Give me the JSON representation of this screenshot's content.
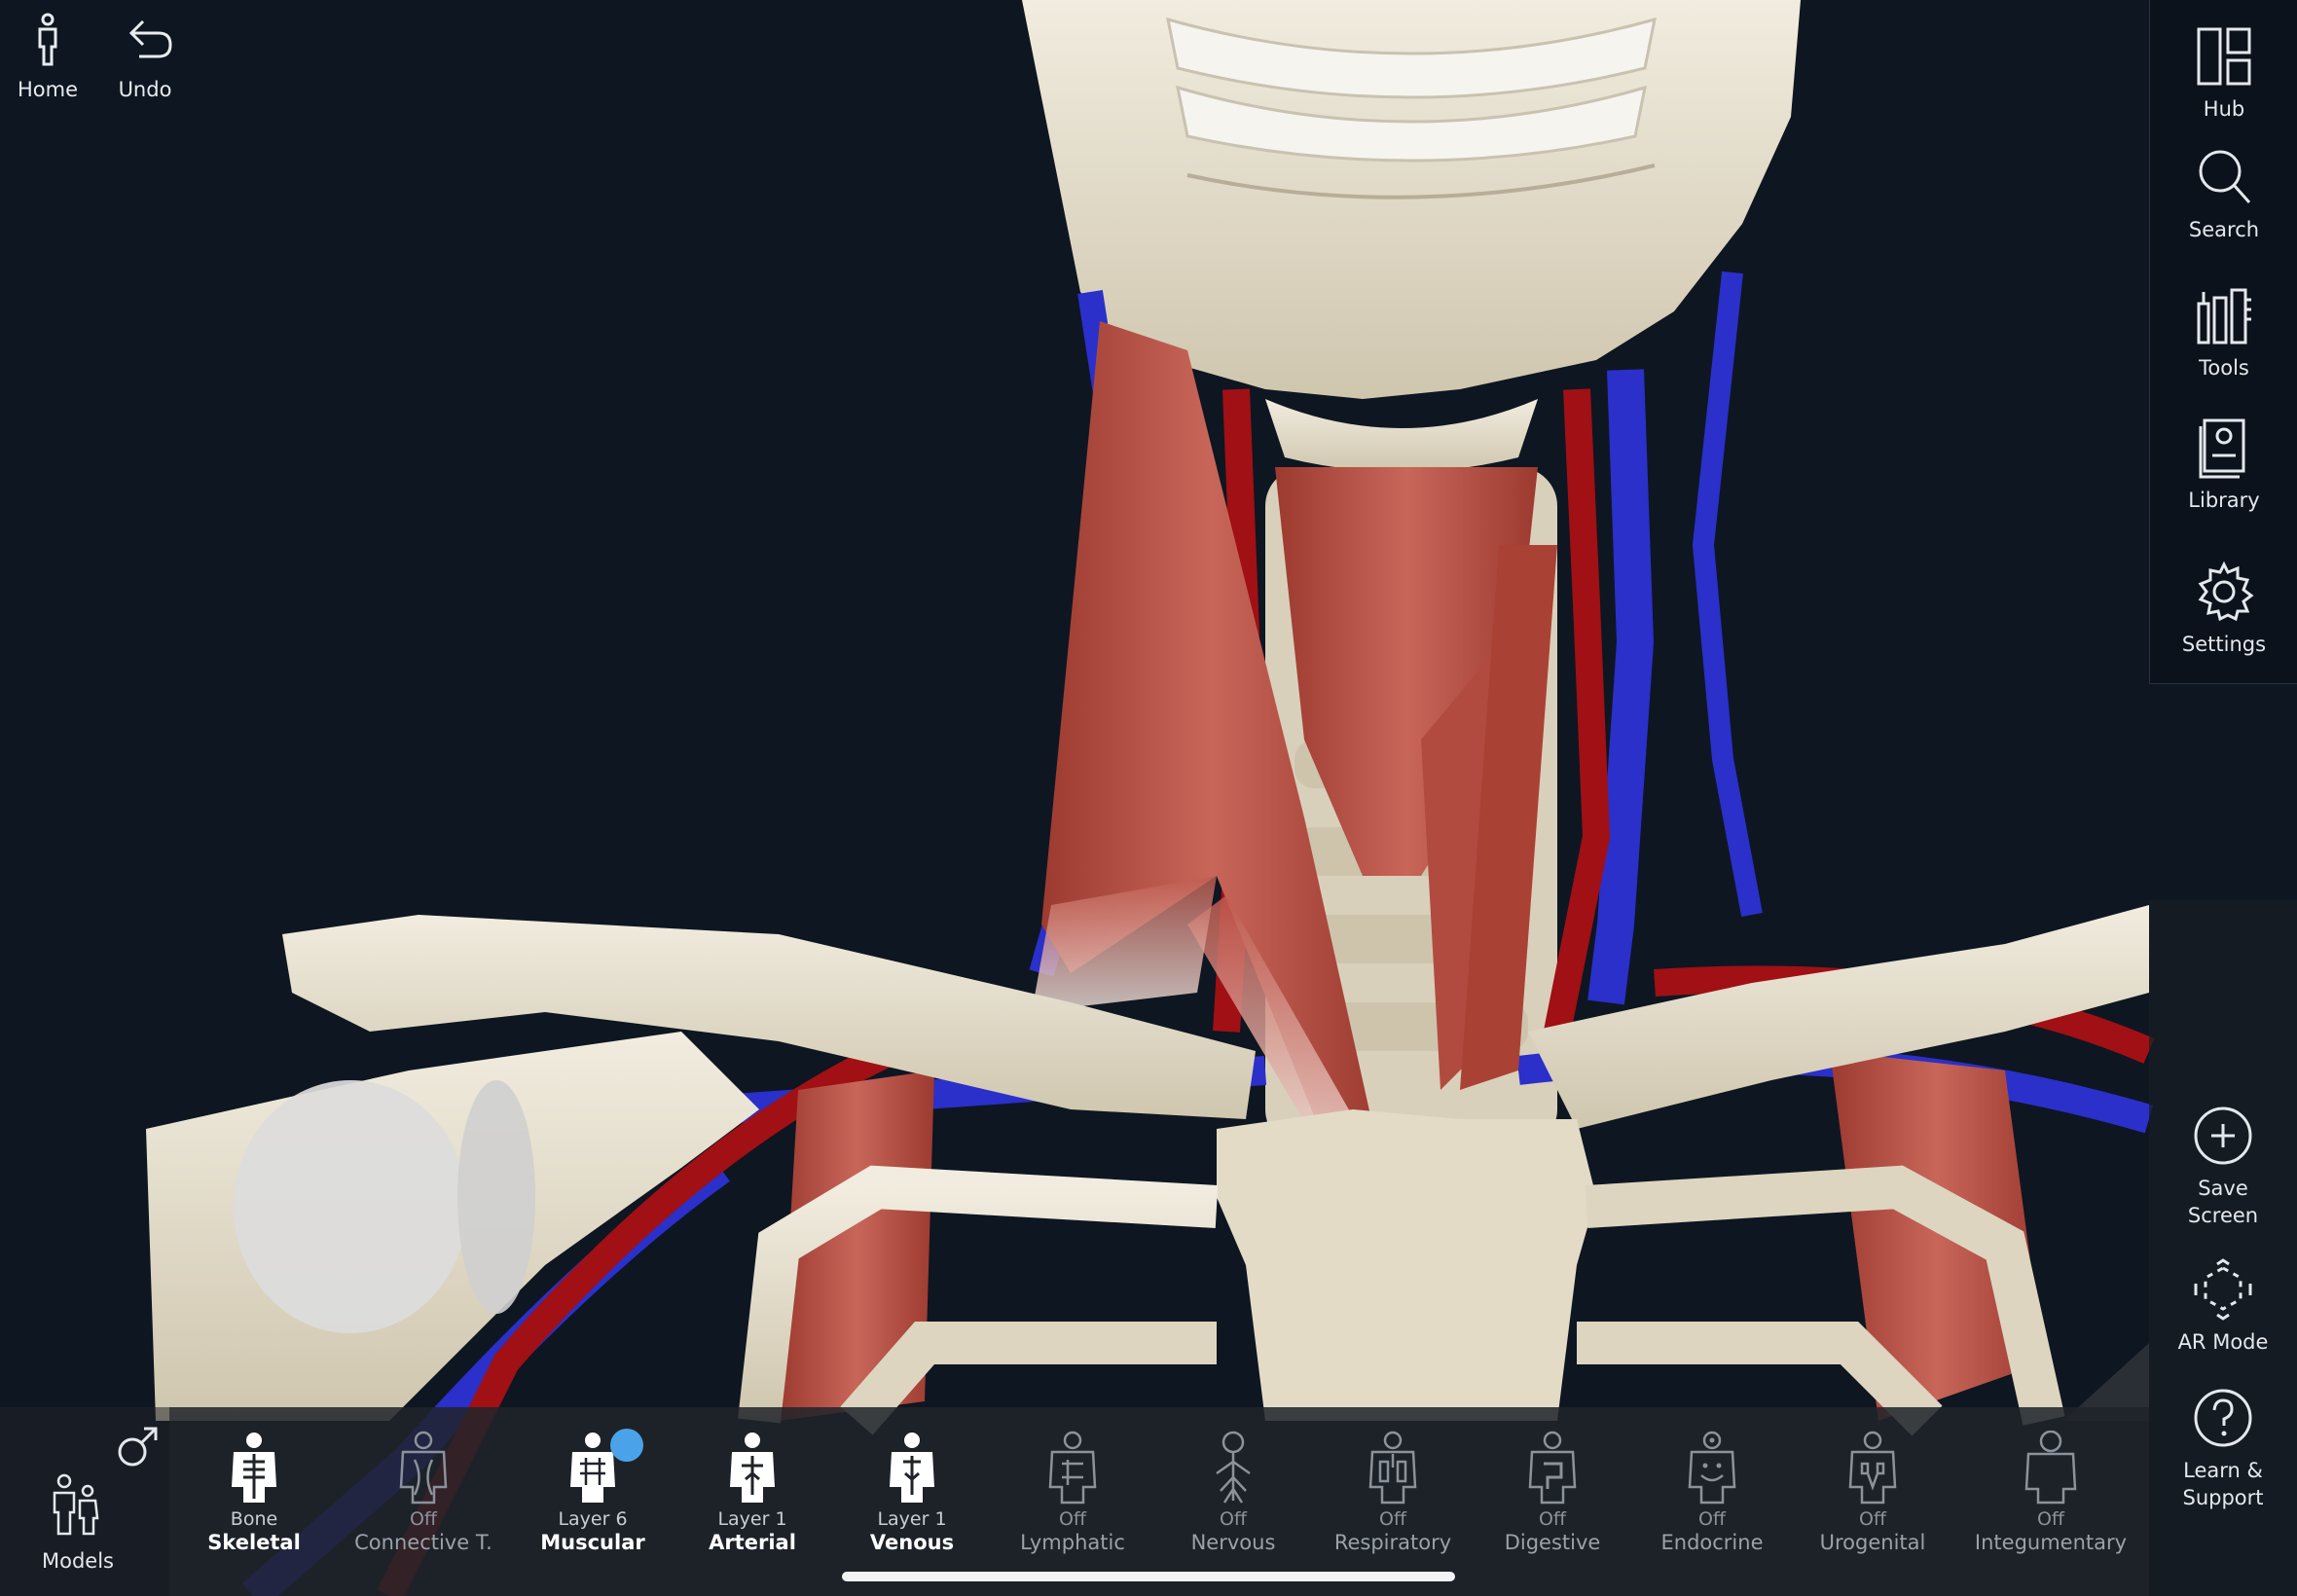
{
  "top_left": {
    "home_label": "Home",
    "undo_label": "Undo"
  },
  "right_panel": {
    "hub_label": "Hub",
    "search_label": "Search",
    "tools_label": "Tools",
    "library_label": "Library",
    "settings_label": "Settings"
  },
  "right_lower": {
    "save_screen_label_1": "Save",
    "save_screen_label_2": "Screen",
    "ar_mode_label": "AR Mode",
    "learn_support_label_1": "Learn &",
    "learn_support_label_2": "Support"
  },
  "models": {
    "label": "Models",
    "gender_icon": "male-symbol-icon"
  },
  "systems": [
    {
      "state": "Bone",
      "name": "Skeletal",
      "active": true
    },
    {
      "state": "Off",
      "name": "Connective T.",
      "active": false
    },
    {
      "state": "Layer 6",
      "name": "Muscular",
      "active": true
    },
    {
      "state": "Layer 1",
      "name": "Arterial",
      "active": true
    },
    {
      "state": "Layer 1",
      "name": "Venous",
      "active": true
    },
    {
      "state": "Off",
      "name": "Lymphatic",
      "active": false
    },
    {
      "state": "Off",
      "name": "Nervous",
      "active": false
    },
    {
      "state": "Off",
      "name": "Respiratory",
      "active": false
    },
    {
      "state": "Off",
      "name": "Digestive",
      "active": false
    },
    {
      "state": "Off",
      "name": "Endocrine",
      "active": false
    },
    {
      "state": "Off",
      "name": "Urogenital",
      "active": false
    },
    {
      "state": "Off",
      "name": "Integumentary",
      "active": false
    }
  ],
  "colors": {
    "background": "#0e1621",
    "bone": "#e8e1cf",
    "muscle": "#b84a3c",
    "artery": "#9e0f12",
    "vein": "#2830c8",
    "accent": "#4aa3e8"
  }
}
